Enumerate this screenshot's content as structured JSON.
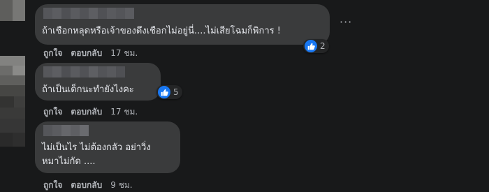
{
  "comments": [
    {
      "text_lines": [
        "ถ้าเชือกหลุดหรือเจ้าของดึงเชือกไม่อยู่นี่....ไม่เสียโฉมก็พิการ !"
      ],
      "reaction_icon": "like-icon",
      "reaction_count": "2",
      "like_label": "ถูกใจ",
      "reply_label": "ตอบกลับ",
      "time": "17 ชม."
    },
    {
      "text_lines": [
        "ถ้าเป็นเด็กนะทำยังไงคะ"
      ],
      "reaction_icon": "like-icon",
      "reaction_count": "5",
      "like_label": "ถูกใจ",
      "reply_label": "ตอบกลับ",
      "time": "17 ชม."
    },
    {
      "text_lines": [
        "ไม่เป็นไร ไม่ต้องกลัว อย่าวิ่ง",
        "หมาไม่กัด ...."
      ],
      "like_label": "ถูกใจ",
      "reply_label": "ตอบกลับ",
      "time": "9 ชม."
    }
  ],
  "more_options_icon": "more-options-icon"
}
